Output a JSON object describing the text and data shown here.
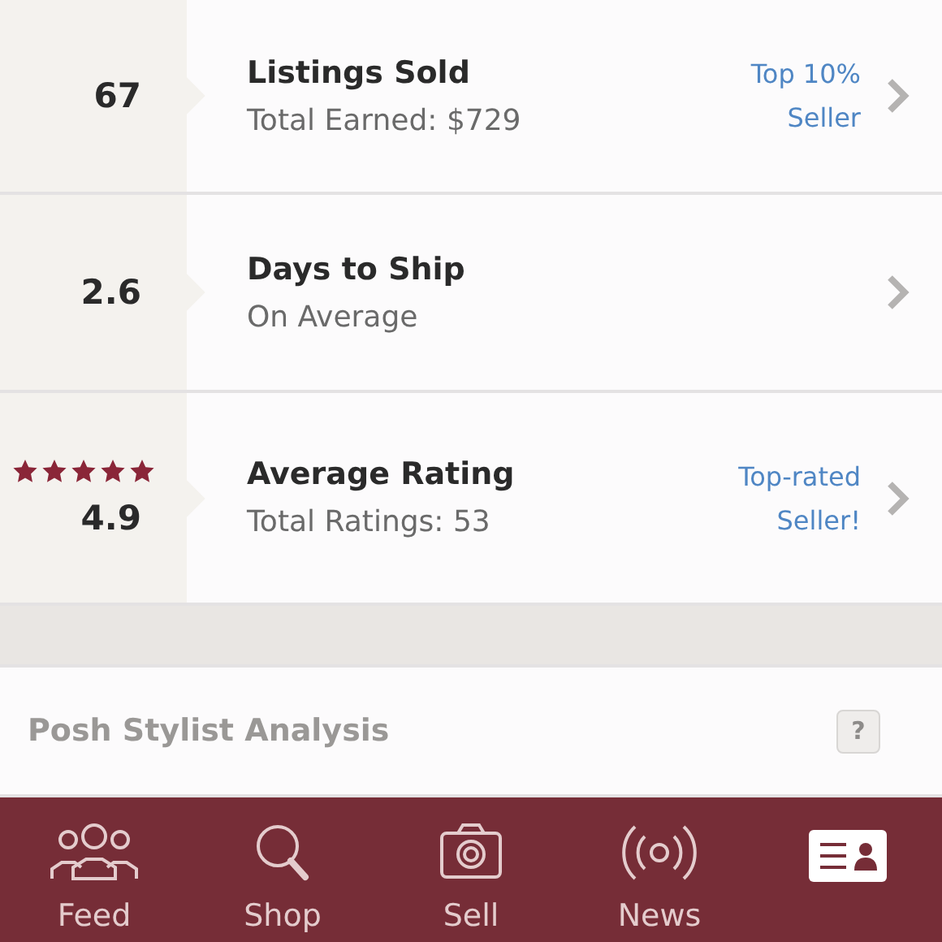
{
  "stats": [
    {
      "value": "67",
      "title": "Listings Sold",
      "subtitle": "Total Earned: $729",
      "badge": "Top 10%\nSeller"
    },
    {
      "value": "2.6",
      "title": "Days to Ship",
      "subtitle": "On Average"
    },
    {
      "value": "4.9",
      "stars": 5,
      "title": "Average Rating",
      "subtitle": "Total Ratings: 53",
      "badge": "Top-rated\nSeller!"
    }
  ],
  "analysis": {
    "title": "Posh Stylist Analysis",
    "help": "?"
  },
  "tabs": [
    {
      "kind": "feed",
      "label": "Feed",
      "selected": false
    },
    {
      "kind": "shop",
      "label": "Shop",
      "selected": false
    },
    {
      "kind": "sell",
      "label": "Sell",
      "selected": false
    },
    {
      "kind": "news",
      "label": "News",
      "selected": false
    },
    {
      "kind": "me",
      "selected": true
    }
  ]
}
